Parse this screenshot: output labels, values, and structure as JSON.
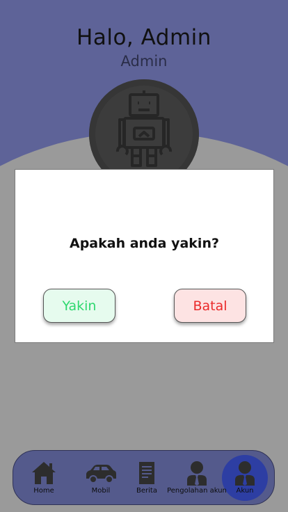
{
  "header": {
    "greeting": "Halo, Admin",
    "role": "Admin",
    "avatar_icon": "robot-icon"
  },
  "dialog": {
    "message": "Apakah anda yakin?",
    "confirm_label": "Yakin",
    "cancel_label": "Batal"
  },
  "navbar": {
    "items": [
      {
        "label": "Home",
        "icon": "home-icon"
      },
      {
        "label": "Mobil",
        "icon": "car-icon"
      },
      {
        "label": "Berita",
        "icon": "news-icon"
      },
      {
        "label": "Pengolahan akun",
        "icon": "user-manage-icon"
      },
      {
        "label": "Akun",
        "icon": "account-icon",
        "active": true
      }
    ]
  },
  "colors": {
    "header": "#5e6398",
    "overlay": "#9a9a9a",
    "navbar": "#545a8c",
    "active_tab": "#2d3ea3",
    "confirm": "#2fd86f",
    "cancel": "#ea2a2a"
  }
}
